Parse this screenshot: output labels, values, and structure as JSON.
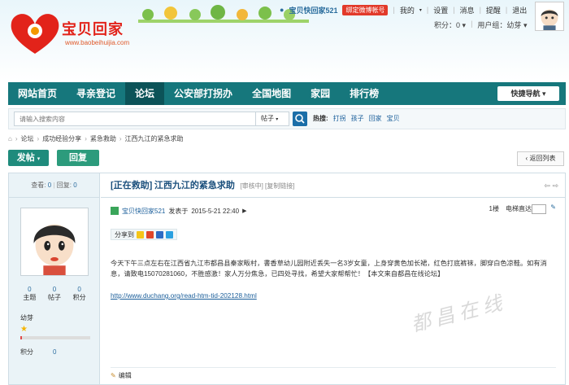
{
  "header": {
    "logo_text": "宝贝回家",
    "logo_url": "www.baobeihuijia.com",
    "username": "宝贝快回家521",
    "bind_weibo": "绑定微博帐号",
    "links": [
      "我的",
      "设置",
      "消息",
      "提醒",
      "退出"
    ],
    "points_label": "积分：",
    "points_value": "0",
    "user_group_label": "用户组：",
    "user_group_value": "幼芽"
  },
  "nav": {
    "items": [
      "网站首页",
      "寻亲登记",
      "论坛",
      "公安部打拐办",
      "全国地图",
      "家园",
      "排行榜"
    ],
    "active_index": 2,
    "quick_nav": "快捷导航"
  },
  "search": {
    "placeholder": "请输入搜索内容",
    "type": "帖子",
    "hot_label": "热搜:",
    "hot_items": [
      "打拐",
      "孩子",
      "回家",
      "宝贝"
    ]
  },
  "breadcrumb": [
    "论坛",
    "成功经验分享",
    "紧急救助",
    "江西九江的紧急求助"
  ],
  "buttons": {
    "post": "发帖",
    "reply": "回复",
    "back_list": "返回列表"
  },
  "thread": {
    "views_label": "查看:",
    "views": "0",
    "replies_label": "回复:",
    "replies": "0",
    "tag": "[正在救助]",
    "title": "江西九江的紧急求助",
    "meta1": "[审核中]",
    "meta2": "[复制链接]",
    "author": "宝贝快回家521",
    "posted_label": "发表于",
    "posted_time": "2015-5-21 22:40",
    "floor": "1楼",
    "jump_label": "电梯直达",
    "share_label": "分享到",
    "content": "今天下午三点左右在江西省九江市都昌县秦家畈村，書香草幼儿园附近丢失一名3岁女童，上身穿黄色加长裙，红色打底裤袜，脚穿白色凉鞋。如有消息，请致电15070281060，不胜感激！家人万分焦急，已四处寻找，希望大家帮帮忙！【本文来自都昌在线论坛】",
    "link": "http://www.duchang.org/read-htm-tid-202128.html",
    "edit": "编辑",
    "watermark": "都昌在线"
  },
  "poster": {
    "stats": [
      {
        "value": "0",
        "label": "主题"
      },
      {
        "value": "0",
        "label": "帖子"
      },
      {
        "value": "0",
        "label": "积分"
      }
    ],
    "level": "幼芽",
    "level_progress": 0.02,
    "points_label": "积分",
    "points_value": "0"
  }
}
